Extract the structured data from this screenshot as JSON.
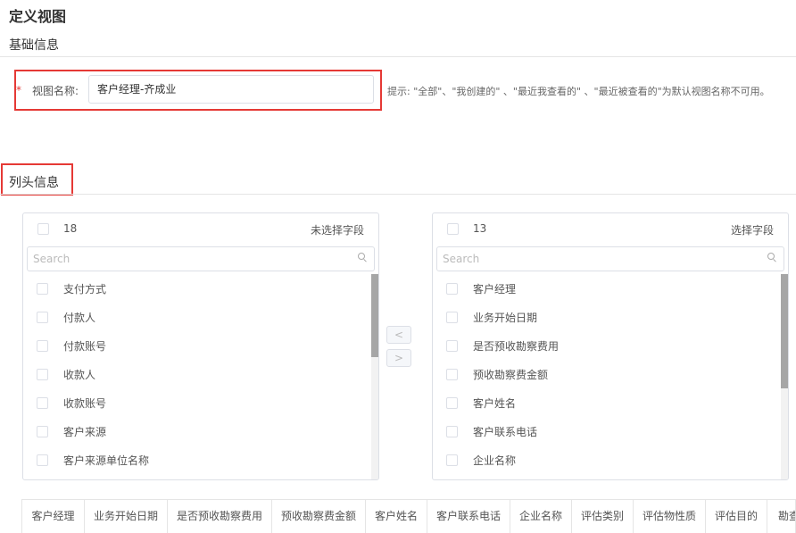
{
  "page_title": "定义视图",
  "basic_info": {
    "section_title": "基础信息",
    "required_mark": "*",
    "view_name_label": "视图名称:",
    "view_name_value": "客户经理-齐成业",
    "hint": "提示: \"全部\"、\"我创建的\" 、\"最近我查看的\" 、\"最近被查看的\"为默认视图名称不可用。"
  },
  "columns_info": {
    "section_title": "列头信息",
    "left_panel": {
      "count": "18",
      "title": "未选择字段",
      "search_placeholder": "Search",
      "items": [
        "支付方式",
        "付款人",
        "付款账号",
        "收款人",
        "收款账号",
        "客户来源",
        "客户来源单位名称"
      ]
    },
    "right_panel": {
      "count": "13",
      "title": "选择字段",
      "search_placeholder": "Search",
      "items": [
        "客户经理",
        "业务开始日期",
        "是否预收勘察费用",
        "预收勘察费金额",
        "客户姓名",
        "客户联系电话",
        "企业名称"
      ]
    },
    "transfer": {
      "left_arrow": "<",
      "right_arrow": ">"
    },
    "table_headers": [
      "客户经理",
      "业务开始日期",
      "是否预收勘察费用",
      "预收勘察费金额",
      "客户姓名",
      "客户联系电话",
      "企业名称",
      "评估类别",
      "评估物性质",
      "评估目的",
      "勘查"
    ]
  }
}
